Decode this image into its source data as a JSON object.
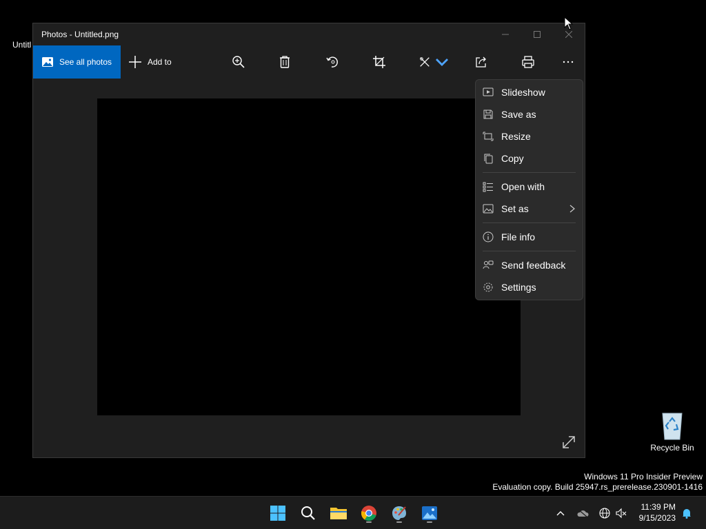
{
  "desktop": {
    "partial_label": "Untitl",
    "recycle_bin_label": "Recycle Bin",
    "watermark_line1": "Windows 11 Pro Insider Preview",
    "watermark_line2": "Evaluation copy. Build 25947.rs_prerelease.230901-1416"
  },
  "window": {
    "title": "Photos - Untitled.png",
    "controls": [
      "minimize-icon",
      "maximize-icon",
      "close-icon"
    ]
  },
  "toolbar": {
    "see_all_label": "See all photos",
    "add_to_label": "Add to",
    "icons": [
      "zoom-in-icon",
      "delete-icon",
      "rotate-icon",
      "crop-icon",
      "edit-icon",
      "share-icon",
      "print-icon",
      "more-options-icon"
    ]
  },
  "menu": {
    "items": [
      {
        "label": "Slideshow",
        "icon": "slideshow-icon"
      },
      {
        "label": "Save as",
        "icon": "save-icon"
      },
      {
        "label": "Resize",
        "icon": "resize-icon"
      },
      {
        "label": "Copy",
        "icon": "copy-icon"
      },
      {
        "label": "Open with",
        "icon": "open-with-icon"
      },
      {
        "label": "Set as",
        "icon": "set-as-icon",
        "has_submenu": true
      },
      {
        "label": "File info",
        "icon": "info-icon"
      },
      {
        "label": "Send feedback",
        "icon": "feedback-icon"
      },
      {
        "label": "Settings",
        "icon": "settings-icon"
      }
    ]
  },
  "taskbar": {
    "apps": [
      "start-icon",
      "search-icon",
      "file-explorer-icon",
      "chrome-icon",
      "paint-icon",
      "photos-icon"
    ],
    "tray": [
      "chevron-up-icon",
      "onedrive-icon",
      "network-icon",
      "volume-muted-icon",
      "notification-bell-icon"
    ],
    "time": "11:39 PM",
    "date": "9/15/2023"
  },
  "colors": {
    "accent": "#0067c0",
    "window_bg": "#1f1f1f",
    "menu_bg": "#2b2b2b"
  }
}
